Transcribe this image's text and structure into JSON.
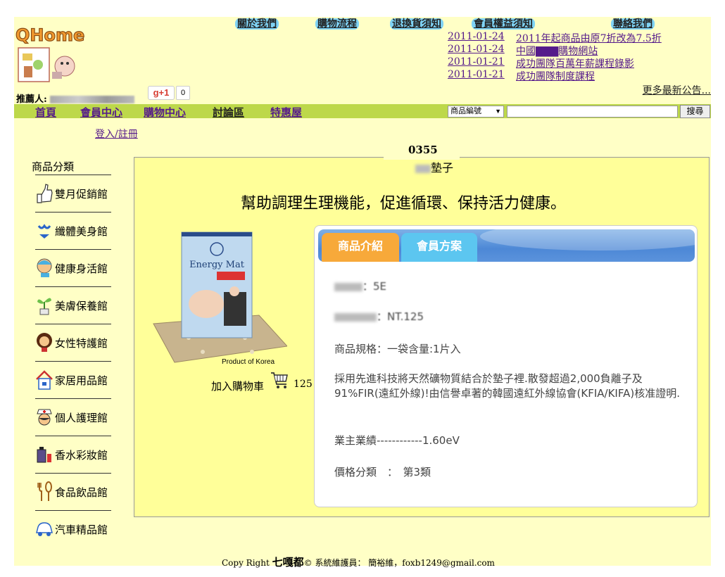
{
  "header": {
    "logo_text": "QHome",
    "top_links": [
      "關於我們",
      "購物流程",
      "退換貨須知",
      "會員權益須知",
      "聯絡我們"
    ],
    "news": [
      {
        "date": "2011-01-24",
        "title": "2011年起商品由原7折改為7.5折"
      },
      {
        "date": "2011-01-24",
        "title": "中國▇▇▇購物網站"
      },
      {
        "date": "2011-01-21",
        "title": "成功團隊百萬年薪課程錄影"
      },
      {
        "date": "2011-01-21",
        "title": "成功團隊制度課程"
      }
    ],
    "more_news": "更多最新公告...",
    "referrer_label": "推薦人:",
    "gplus_label": "g+1",
    "gplus_count": "0"
  },
  "nav": {
    "items": [
      "首頁",
      "會員中心",
      "購物中心",
      "討論區",
      "特惠屋"
    ],
    "search_select": "商品編號",
    "search_button": "搜尋"
  },
  "login_link": "登入/註冊",
  "sidebar": {
    "title": "商品分類",
    "items": [
      {
        "label": "雙月促銷館",
        "icon": "thumbs-up-icon"
      },
      {
        "label": "纖體美身館",
        "icon": "bikini-icon"
      },
      {
        "label": "健康身活館",
        "icon": "person-health-icon"
      },
      {
        "label": "美膚保養館",
        "icon": "sprout-icon"
      },
      {
        "label": "女性特護館",
        "icon": "woman-icon"
      },
      {
        "label": "家居用品館",
        "icon": "house-icon"
      },
      {
        "label": "個人護理館",
        "icon": "nurse-icon"
      },
      {
        "label": "香水彩妝館",
        "icon": "perfume-icon"
      },
      {
        "label": "食品飲品館",
        "icon": "utensils-icon"
      },
      {
        "label": "汽車精品館",
        "icon": "car-icon"
      }
    ]
  },
  "product": {
    "code": "0355",
    "name_suffix": "墊子",
    "slogan": "幫助調理生理機能，促進循環、保持活力健康。",
    "made_in": "Product of Korea",
    "add_to_cart": "加入購物車",
    "price_small": "125",
    "image_box_title": "Energy Mat",
    "tabs": [
      "商品介紹",
      "會員方案"
    ],
    "info_line1_value": "：5E",
    "info_line2_value": "：NT.125",
    "spec": "商品規格：一袋含量:1片入",
    "description": "採用先進科技將天然礦物質結合於墊子裡.散發超過2,000負離子及91%FIR(遠紅外線)!由信譽卓著的韓國遠紅外線協會(KFIA/KIFA)核准證明.",
    "performance": "業主業績------------1.60eV",
    "price_class": "價格分類　：　第3類"
  },
  "footer": {
    "prefix": "Copy Right ",
    "brand": "七嘎都",
    "suffix": "© 系統維護員： 簡裕維，foxb1249@gmail.com"
  },
  "colors": {
    "background": "#ffffc6",
    "nav_bar": "#bdd84a",
    "panel": "#ffff99",
    "tab_active": "#f7a93a",
    "tab_inactive": "#5cc6f0",
    "top_link_bg": "#7fd3f5"
  }
}
